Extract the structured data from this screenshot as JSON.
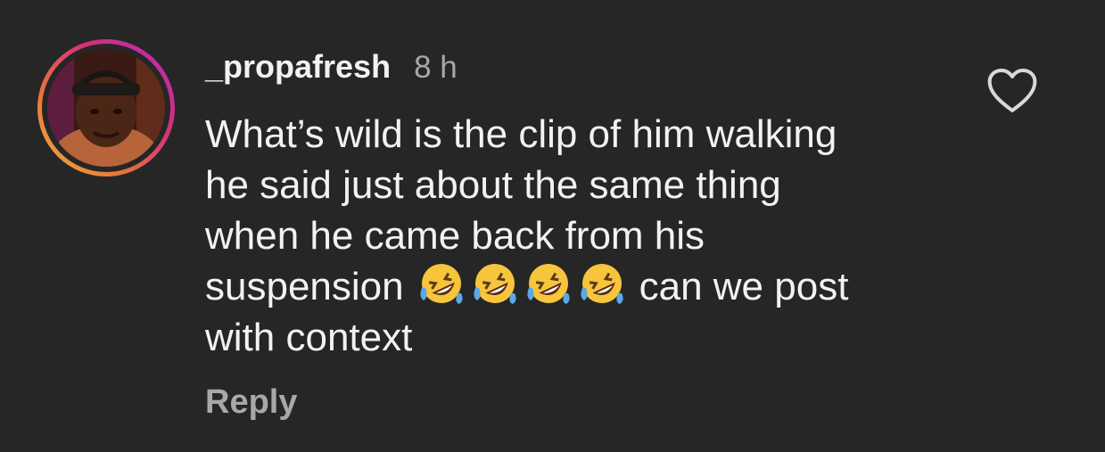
{
  "comment": {
    "username": "_propafresh",
    "timestamp": "8 h",
    "text_lines": [
      "What’s wild is the clip of him walking",
      "he said just about the same thing",
      "when he came back from his"
    ],
    "line4_before": "suspension",
    "emojis": [
      "rolling-on-floor-laughing-emoji",
      "rolling-on-floor-laughing-emoji",
      "rolling-on-floor-laughing-emoji",
      "rolling-on-floor-laughing-emoji"
    ],
    "line4_after": "can we post",
    "line5": "with context",
    "reply_label": "Reply",
    "like_icon": "heart-outline-icon"
  },
  "colors": {
    "background": "#262626",
    "primary_text": "#f2f2f2",
    "secondary_text": "#a8a8a8",
    "story_ring": [
      "#f2b33d",
      "#e8773a",
      "#d62f7a",
      "#b02cb8"
    ]
  }
}
